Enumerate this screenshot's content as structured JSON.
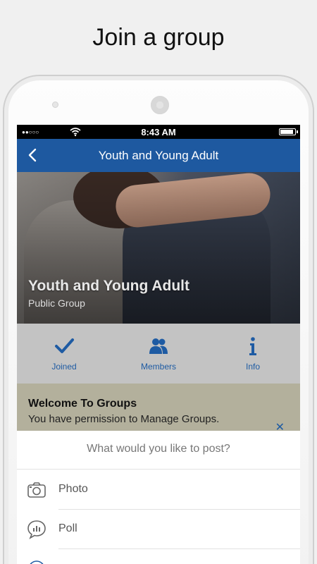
{
  "headline": "Join a group",
  "status_bar": {
    "signal": "●●○○○",
    "time": "8:43 AM"
  },
  "nav": {
    "title": "Youth and Young Adult"
  },
  "hero": {
    "title": "Youth and Young Adult",
    "subtitle": "Public Group"
  },
  "actions": [
    {
      "label": "Joined",
      "icon": "checkmark-icon"
    },
    {
      "label": "Members",
      "icon": "members-icon"
    },
    {
      "label": "Info",
      "icon": "info-icon"
    }
  ],
  "welcome": {
    "title": "Welcome To Groups",
    "body": "You have permission to Manage Groups."
  },
  "sheet": {
    "prompt": "What would you like to post?",
    "options": [
      {
        "label": "Photo",
        "icon": "camera-icon"
      },
      {
        "label": "Poll",
        "icon": "poll-icon"
      }
    ]
  },
  "colors": {
    "nav_blue": "#1e59a0",
    "accent_blue": "#1e5ba3"
  }
}
